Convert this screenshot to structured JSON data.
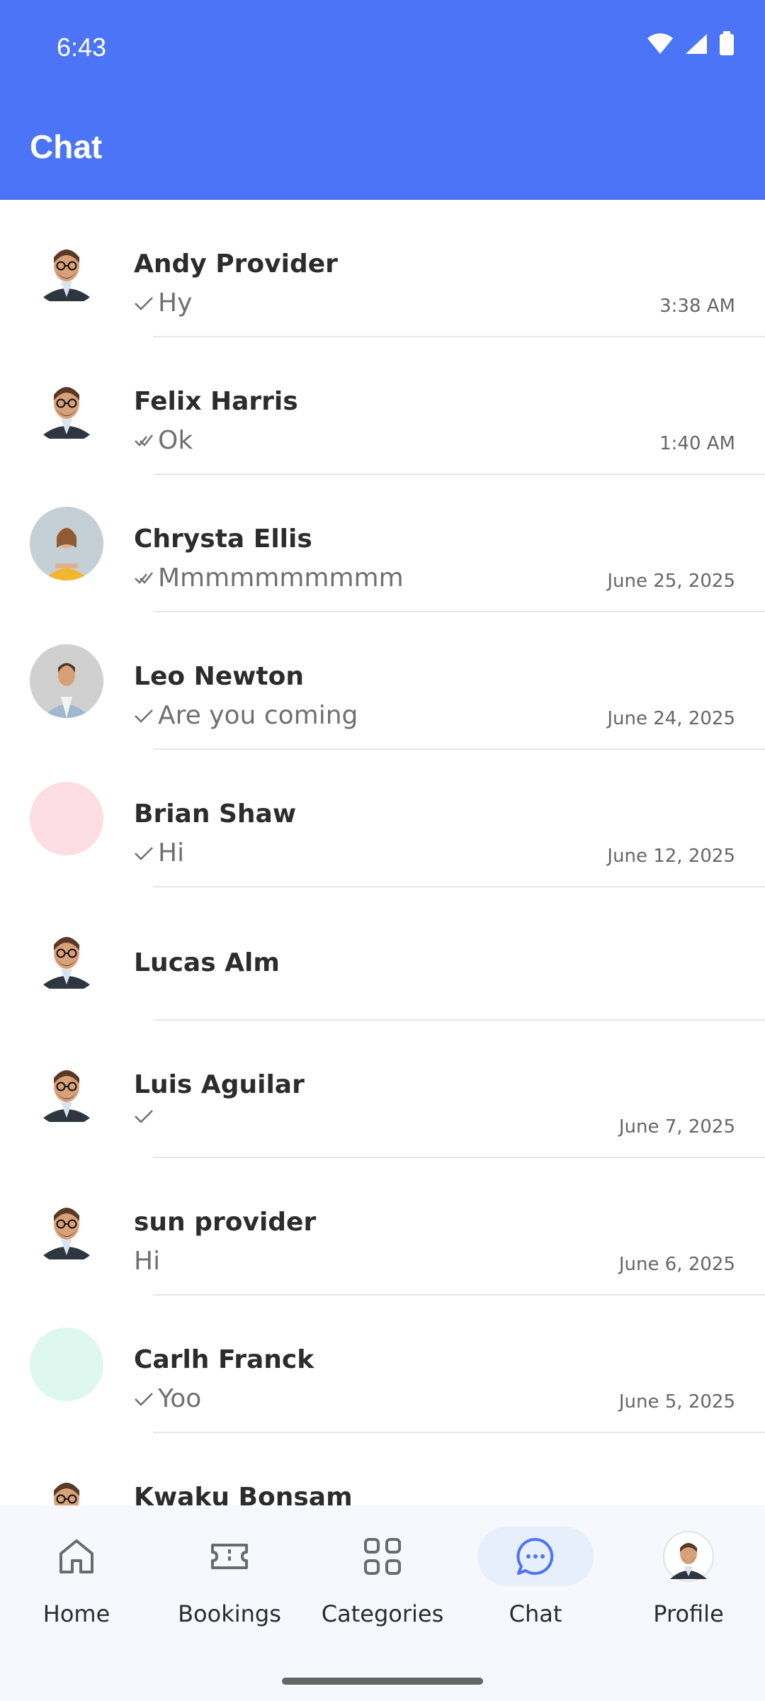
{
  "status": {
    "time": "6:43"
  },
  "header": {
    "title": "Chat"
  },
  "chats": [
    {
      "name": "Andy Provider",
      "message": "Hy",
      "time": "3:38 AM",
      "check": "single",
      "avatar": "avatar-male-glasses"
    },
    {
      "name": "Felix Harris",
      "message": "Ok",
      "time": "1:40 AM",
      "check": "double",
      "avatar": "avatar-male-glasses"
    },
    {
      "name": "Chrysta Ellis",
      "message": "Mmmmmmmmmm",
      "time": "June 25, 2025",
      "check": "double",
      "avatar": "photo-female"
    },
    {
      "name": "Leo Newton",
      "message": "Are you coming",
      "time": "June 24, 2025",
      "check": "single",
      "avatar": "photo-male"
    },
    {
      "name": "Brian Shaw",
      "message": "Hi",
      "time": "June 12, 2025",
      "check": "single",
      "avatar": "pink-circle"
    },
    {
      "name": "Lucas Alm",
      "message": "",
      "time": "",
      "check": "none",
      "avatar": "avatar-male-glasses"
    },
    {
      "name": "Luis Aguilar",
      "message": "",
      "time": "June 7, 2025",
      "check": "single",
      "avatar": "avatar-male-glasses"
    },
    {
      "name": "sun provider",
      "message": "Hi",
      "time": "June 6, 2025",
      "check": "none",
      "avatar": "avatar-male-glasses"
    },
    {
      "name": "Carlh Franck",
      "message": "Yoo",
      "time": "June 5, 2025",
      "check": "single",
      "avatar": "mint-circle"
    },
    {
      "name": "Kwaku Bonsam",
      "message": "",
      "time": "",
      "check": "none",
      "avatar": "avatar-male-glasses"
    }
  ],
  "nav": {
    "home": "Home",
    "bookings": "Bookings",
    "categories": "Categories",
    "chat": "Chat",
    "profile": "Profile"
  },
  "colors": {
    "header": "#4b74f6",
    "active_nav_bg": "#e7eefc",
    "text_dark": "#2c2c2c",
    "text_muted": "#707070"
  }
}
